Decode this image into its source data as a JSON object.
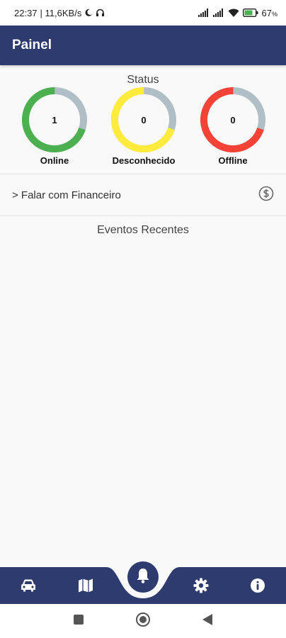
{
  "status_bar": {
    "time": "22:37",
    "speed": "| 11,6KB/s",
    "battery": "67"
  },
  "app_bar": {
    "title": "Painel"
  },
  "status": {
    "heading": "Status",
    "gauges": [
      {
        "label": "Online",
        "value": "1",
        "color": "#4caf50",
        "fraction": 0.7
      },
      {
        "label": "Desconhecido",
        "value": "0",
        "color": "#ffeb3b",
        "fraction": 0.7
      },
      {
        "label": "Offline",
        "value": "0",
        "color": "#f44336",
        "fraction": 0.7
      }
    ],
    "track_color": "#b0bec5"
  },
  "finance": {
    "label": "> Falar com Financeiro",
    "icon": "dollar-circle-icon"
  },
  "events": {
    "heading": "Eventos Recentes"
  },
  "bottom_nav": {
    "items": [
      "car-icon",
      "map-icon",
      "bell-icon",
      "gear-icon",
      "info-icon"
    ],
    "color": "#2e3b6e"
  },
  "android_nav": [
    "square-icon",
    "circle-icon",
    "back-triangle-icon"
  ]
}
